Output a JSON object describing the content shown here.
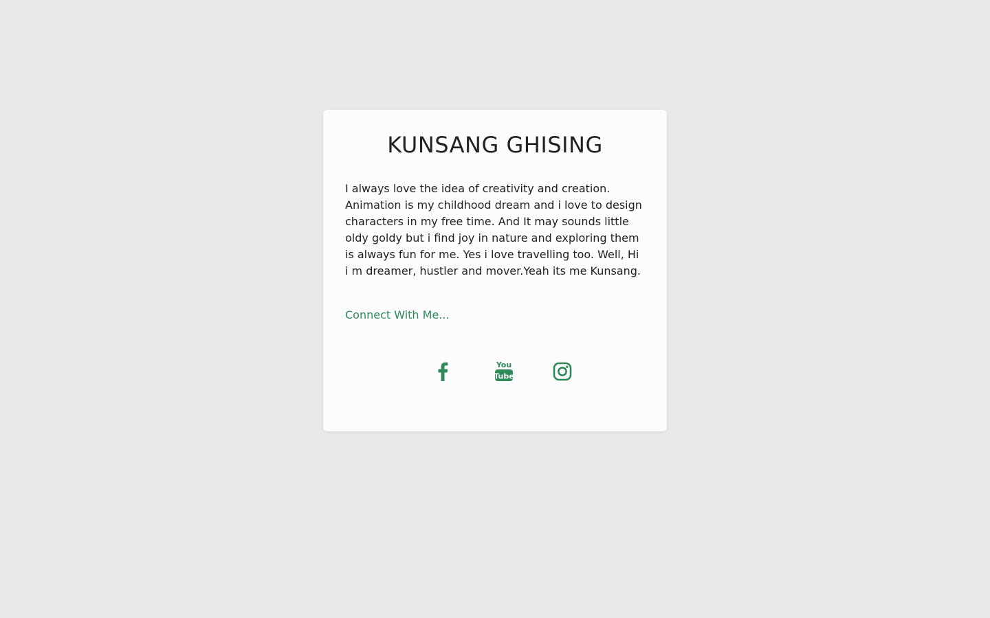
{
  "profile": {
    "name": "KUNSANG GHISING",
    "bio": "I always love the idea of creativity and creation. Animation is my childhood dream and i love to design characters in my free time. And It may sounds little oldy goldy but i find joy in nature and exploring them is always fun for me. Yes i love travelling too. Well, Hi i m dreamer, hustler and mover.Yeah its me Kunsang.",
    "connect_label": "Connect With Me..."
  },
  "socials": [
    {
      "icon": "facebook-icon"
    },
    {
      "icon": "youtube-icon",
      "text_top": "You",
      "text_bottom": "Tube"
    },
    {
      "icon": "instagram-icon"
    }
  ],
  "colors": {
    "background": "#e8e8e8",
    "card": "#fcfcfe",
    "accent": "#2e8b57",
    "text": "#212121"
  }
}
